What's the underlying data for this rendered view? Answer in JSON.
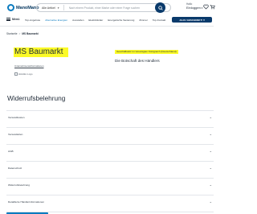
{
  "header": {
    "logo_text": "ManoMano",
    "search_category": "Alle Artikel",
    "search_placeholder": "Nach einem Produkt, einer Marke oder einer Frage suchen",
    "account_greeting": "Hallo",
    "account_login": "Einloggen"
  },
  "nav": {
    "menu_label": "Menü",
    "links": [
      "Top-Angebote",
      "Alternative Energien",
      "Ausstellen",
      "Elektrikfelder",
      "Energetische Sanierung",
      "Zimmer",
      "Top-Kontakt"
    ],
    "cta_label": "JAJA! GESCHENKT!"
  },
  "breadcrumb": {
    "home": "Startseite",
    "current": "MS Baumarkt"
  },
  "seller": {
    "name": "MS Baumarkt",
    "link": "Unternehmensinformationen",
    "logo_alt": "Händler-Logo",
    "badge": "Geschäftssitz im Vereinigten Königreich (Deutschland)",
    "tagline": "Die Botschaft des Händlers"
  },
  "withdrawal": {
    "title": "Widerrufsbelehrung",
    "items": [
      "Versandkosten",
      "Versandarten",
      "AGB",
      "Datenschutz",
      "Widerrufsbelehrung",
      "Detaillierte Händlerinformationen"
    ]
  },
  "colors": {
    "brand_dark": "#0a3a6b",
    "brand_accent": "#0b7bbf",
    "highlight": "#fbfa27"
  }
}
